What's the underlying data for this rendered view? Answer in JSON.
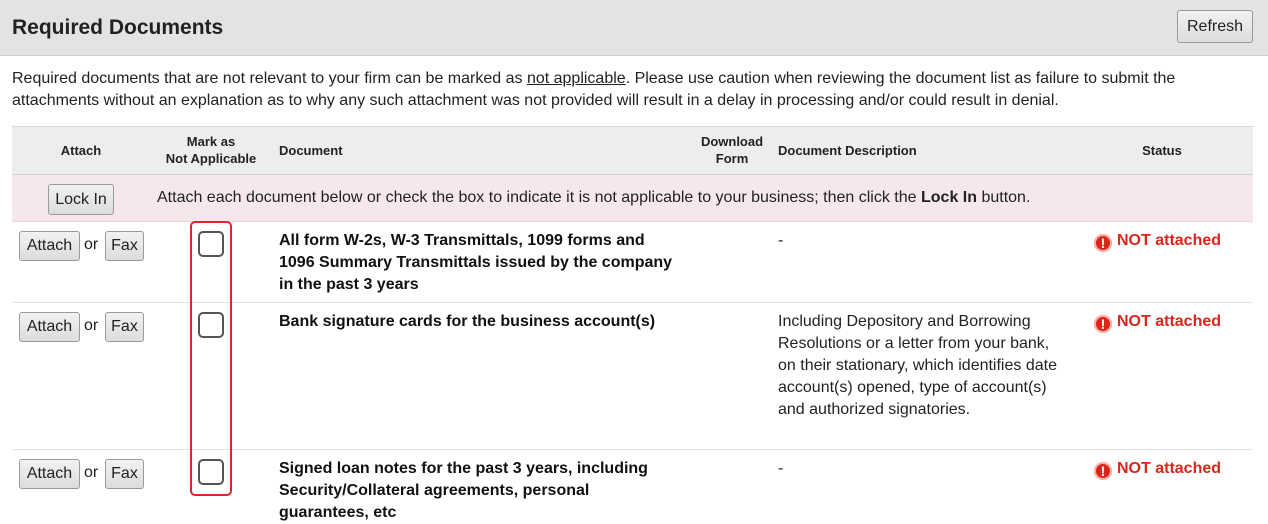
{
  "header": {
    "title": "Required Documents",
    "refresh_label": "Refresh"
  },
  "intro": {
    "part1": "Required documents that are not relevant to your firm can be marked as ",
    "link": "not applicable",
    "part2": ". Please use caution when reviewing the document list as failure to submit the attachments without an explanation as to why any such attachment was not provided will result in a delay in processing and/or could result in denial."
  },
  "columns": {
    "attach": "Attach",
    "mark_na_line1": "Mark as",
    "mark_na_line2": "Not Applicable",
    "document": "Document",
    "download_line1": "Download",
    "download_line2": "Form",
    "description": "Document Description",
    "status": "Status"
  },
  "lock_row": {
    "button_label": "Lock In",
    "message_pre": "Attach each document below or check the box to indicate it is not applicable to your business; then click the ",
    "message_bold": "Lock In",
    "message_post": " button."
  },
  "row_controls": {
    "attach_label": "Attach",
    "or_text": "or",
    "fax_label": "Fax"
  },
  "rows": [
    {
      "document": "All form W-2s, W-3 Transmittals, 1099 forms and 1096 Summary Transmittals issued by the company in the past 3 years",
      "description": "-",
      "status": "NOT attached",
      "not_applicable": false
    },
    {
      "document": "Bank signature cards for the business account(s)",
      "description": "Including Depository and Borrowing Resolutions or a letter from your bank, on their stationary, which identifies date account(s) opened, type of account(s) and authorized signatories.",
      "status": "NOT attached",
      "not_applicable": false
    },
    {
      "document": "Signed loan notes for the past 3 years, including Security/Collateral agreements, personal guarantees, etc",
      "description": "-",
      "status": "NOT attached",
      "not_applicable": false
    }
  ],
  "colors": {
    "status_red": "#d9261c",
    "highlight_red": "#e0232e",
    "lock_row_bg": "#f6e8ea",
    "header_bg": "#e3e3e3"
  },
  "icons": {
    "status": "warning-icon"
  }
}
